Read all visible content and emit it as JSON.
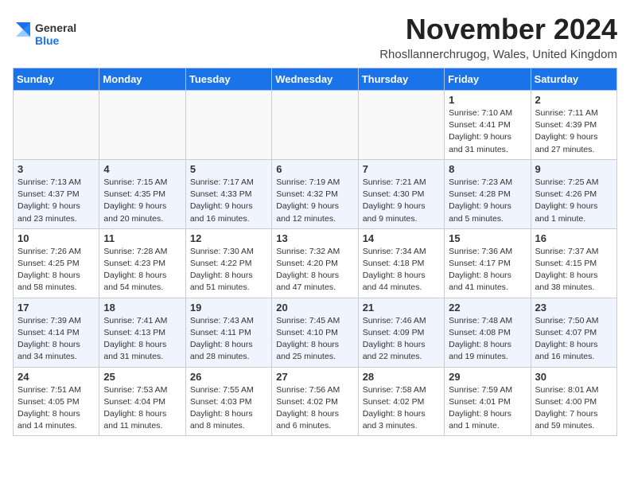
{
  "logo": {
    "line1": "General",
    "line2": "Blue"
  },
  "header": {
    "month": "November 2024",
    "location": "Rhosllannerchrugog, Wales, United Kingdom"
  },
  "weekdays": [
    "Sunday",
    "Monday",
    "Tuesday",
    "Wednesday",
    "Thursday",
    "Friday",
    "Saturday"
  ],
  "weeks": [
    [
      {
        "day": "",
        "detail": ""
      },
      {
        "day": "",
        "detail": ""
      },
      {
        "day": "",
        "detail": ""
      },
      {
        "day": "",
        "detail": ""
      },
      {
        "day": "",
        "detail": ""
      },
      {
        "day": "1",
        "detail": "Sunrise: 7:10 AM\nSunset: 4:41 PM\nDaylight: 9 hours\nand 31 minutes."
      },
      {
        "day": "2",
        "detail": "Sunrise: 7:11 AM\nSunset: 4:39 PM\nDaylight: 9 hours\nand 27 minutes."
      }
    ],
    [
      {
        "day": "3",
        "detail": "Sunrise: 7:13 AM\nSunset: 4:37 PM\nDaylight: 9 hours\nand 23 minutes."
      },
      {
        "day": "4",
        "detail": "Sunrise: 7:15 AM\nSunset: 4:35 PM\nDaylight: 9 hours\nand 20 minutes."
      },
      {
        "day": "5",
        "detail": "Sunrise: 7:17 AM\nSunset: 4:33 PM\nDaylight: 9 hours\nand 16 minutes."
      },
      {
        "day": "6",
        "detail": "Sunrise: 7:19 AM\nSunset: 4:32 PM\nDaylight: 9 hours\nand 12 minutes."
      },
      {
        "day": "7",
        "detail": "Sunrise: 7:21 AM\nSunset: 4:30 PM\nDaylight: 9 hours\nand 9 minutes."
      },
      {
        "day": "8",
        "detail": "Sunrise: 7:23 AM\nSunset: 4:28 PM\nDaylight: 9 hours\nand 5 minutes."
      },
      {
        "day": "9",
        "detail": "Sunrise: 7:25 AM\nSunset: 4:26 PM\nDaylight: 9 hours\nand 1 minute."
      }
    ],
    [
      {
        "day": "10",
        "detail": "Sunrise: 7:26 AM\nSunset: 4:25 PM\nDaylight: 8 hours\nand 58 minutes."
      },
      {
        "day": "11",
        "detail": "Sunrise: 7:28 AM\nSunset: 4:23 PM\nDaylight: 8 hours\nand 54 minutes."
      },
      {
        "day": "12",
        "detail": "Sunrise: 7:30 AM\nSunset: 4:22 PM\nDaylight: 8 hours\nand 51 minutes."
      },
      {
        "day": "13",
        "detail": "Sunrise: 7:32 AM\nSunset: 4:20 PM\nDaylight: 8 hours\nand 47 minutes."
      },
      {
        "day": "14",
        "detail": "Sunrise: 7:34 AM\nSunset: 4:18 PM\nDaylight: 8 hours\nand 44 minutes."
      },
      {
        "day": "15",
        "detail": "Sunrise: 7:36 AM\nSunset: 4:17 PM\nDaylight: 8 hours\nand 41 minutes."
      },
      {
        "day": "16",
        "detail": "Sunrise: 7:37 AM\nSunset: 4:15 PM\nDaylight: 8 hours\nand 38 minutes."
      }
    ],
    [
      {
        "day": "17",
        "detail": "Sunrise: 7:39 AM\nSunset: 4:14 PM\nDaylight: 8 hours\nand 34 minutes."
      },
      {
        "day": "18",
        "detail": "Sunrise: 7:41 AM\nSunset: 4:13 PM\nDaylight: 8 hours\nand 31 minutes."
      },
      {
        "day": "19",
        "detail": "Sunrise: 7:43 AM\nSunset: 4:11 PM\nDaylight: 8 hours\nand 28 minutes."
      },
      {
        "day": "20",
        "detail": "Sunrise: 7:45 AM\nSunset: 4:10 PM\nDaylight: 8 hours\nand 25 minutes."
      },
      {
        "day": "21",
        "detail": "Sunrise: 7:46 AM\nSunset: 4:09 PM\nDaylight: 8 hours\nand 22 minutes."
      },
      {
        "day": "22",
        "detail": "Sunrise: 7:48 AM\nSunset: 4:08 PM\nDaylight: 8 hours\nand 19 minutes."
      },
      {
        "day": "23",
        "detail": "Sunrise: 7:50 AM\nSunset: 4:07 PM\nDaylight: 8 hours\nand 16 minutes."
      }
    ],
    [
      {
        "day": "24",
        "detail": "Sunrise: 7:51 AM\nSunset: 4:05 PM\nDaylight: 8 hours\nand 14 minutes."
      },
      {
        "day": "25",
        "detail": "Sunrise: 7:53 AM\nSunset: 4:04 PM\nDaylight: 8 hours\nand 11 minutes."
      },
      {
        "day": "26",
        "detail": "Sunrise: 7:55 AM\nSunset: 4:03 PM\nDaylight: 8 hours\nand 8 minutes."
      },
      {
        "day": "27",
        "detail": "Sunrise: 7:56 AM\nSunset: 4:02 PM\nDaylight: 8 hours\nand 6 minutes."
      },
      {
        "day": "28",
        "detail": "Sunrise: 7:58 AM\nSunset: 4:02 PM\nDaylight: 8 hours\nand 3 minutes."
      },
      {
        "day": "29",
        "detail": "Sunrise: 7:59 AM\nSunset: 4:01 PM\nDaylight: 8 hours\nand 1 minute."
      },
      {
        "day": "30",
        "detail": "Sunrise: 8:01 AM\nSunset: 4:00 PM\nDaylight: 7 hours\nand 59 minutes."
      }
    ]
  ]
}
